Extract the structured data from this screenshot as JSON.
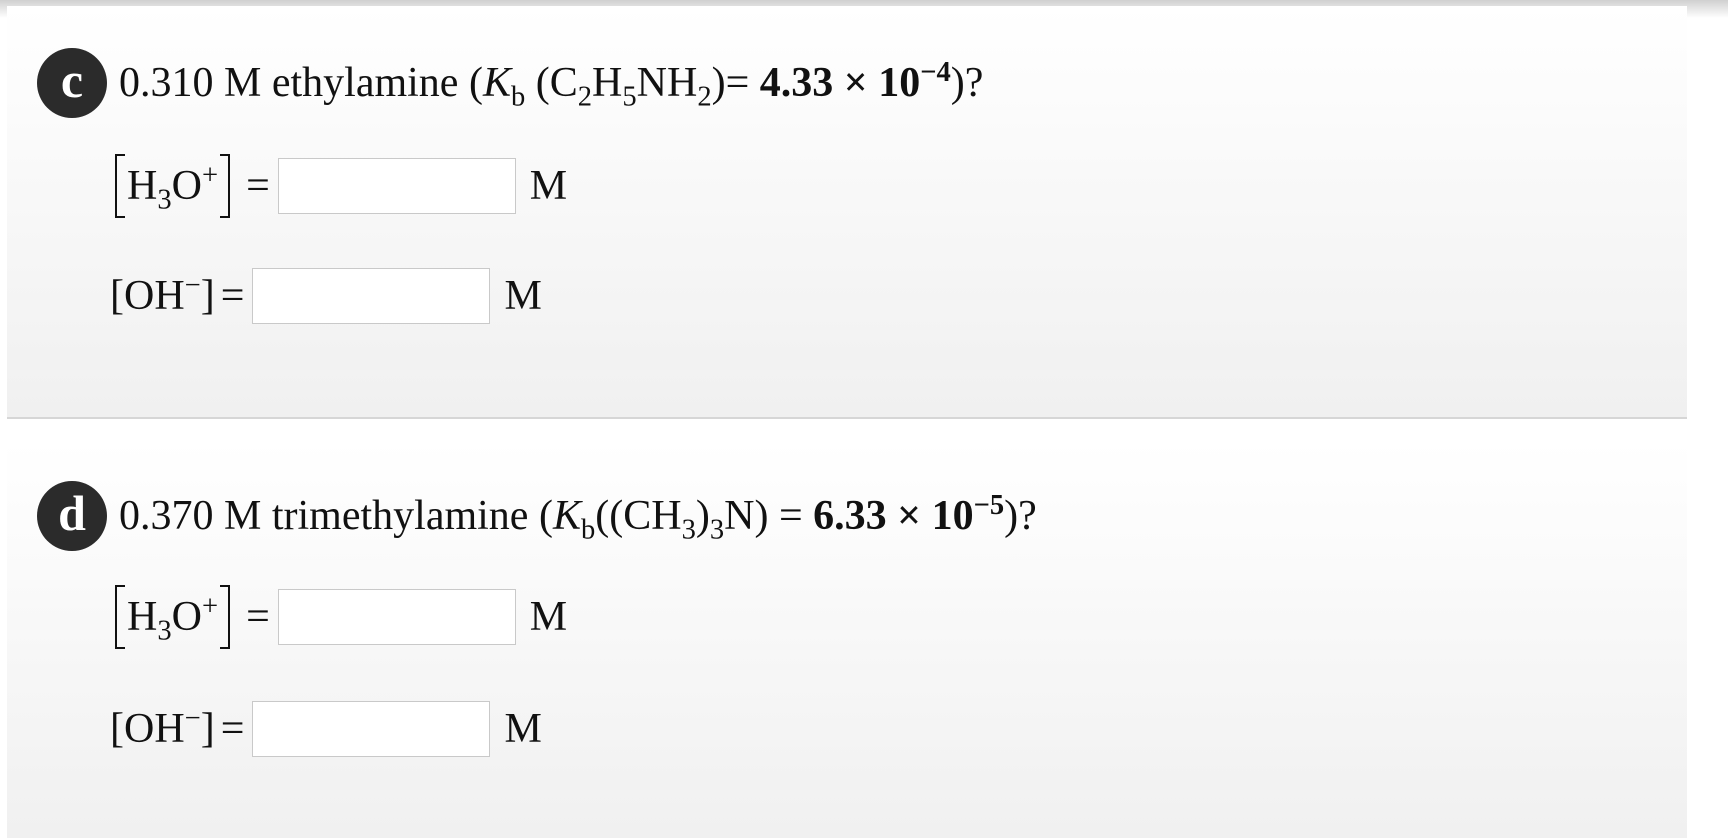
{
  "parts": [
    {
      "badge": "c",
      "concentration": "0.310 M ethylamine (",
      "kb_symbol": "K",
      "kb_sub": "b",
      "formula_pre": " (C",
      "formula_sub1": "2",
      "formula_mid1": "H",
      "formula_sub2": "5",
      "formula_mid2": "NH",
      "formula_sub3": "2",
      "formula_post": ")= ",
      "value": "4.33 × 10",
      "exponent": "−4",
      "tail": ")?",
      "h3o_label": "H",
      "h3o_sub": "3",
      "h3o_o": "O",
      "h3o_charge": "+",
      "h3o_eq": "=",
      "h3o_value": "",
      "h3o_unit": "M",
      "oh_label": "[OH",
      "oh_charge": "−",
      "oh_close": "]",
      "oh_eq": "=",
      "oh_value": "",
      "oh_unit": "M"
    },
    {
      "badge": "d",
      "concentration": "0.370 M trimethylamine (",
      "kb_symbol": "K",
      "kb_sub": "b",
      "formula_pre": "((CH",
      "formula_sub1": "3",
      "formula_mid1": ")",
      "formula_sub2": "3",
      "formula_mid2": "N)",
      "formula_sub3": "",
      "formula_post": " = ",
      "value": "6.33 × 10",
      "exponent": "−5",
      "tail": ")?",
      "h3o_label": "H",
      "h3o_sub": "3",
      "h3o_o": "O",
      "h3o_charge": "+",
      "h3o_eq": "=",
      "h3o_value": "",
      "h3o_unit": "M",
      "oh_label": "[OH",
      "oh_charge": "−",
      "oh_close": "]",
      "oh_eq": "=",
      "oh_value": "",
      "oh_unit": "M"
    }
  ]
}
